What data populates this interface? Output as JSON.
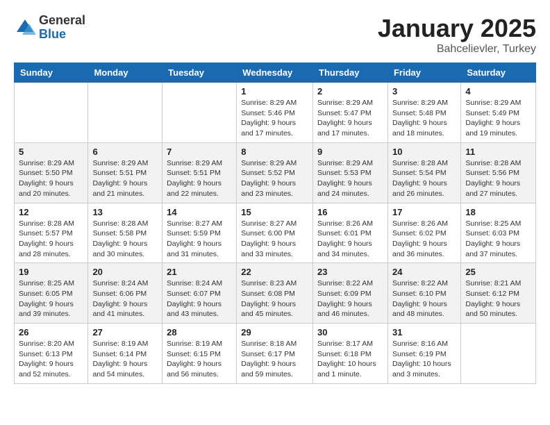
{
  "logo": {
    "general": "General",
    "blue": "Blue"
  },
  "title": {
    "month": "January 2025",
    "location": "Bahcelievler, Turkey"
  },
  "headers": [
    "Sunday",
    "Monday",
    "Tuesday",
    "Wednesday",
    "Thursday",
    "Friday",
    "Saturday"
  ],
  "weeks": [
    [
      {
        "num": "",
        "info": ""
      },
      {
        "num": "",
        "info": ""
      },
      {
        "num": "",
        "info": ""
      },
      {
        "num": "1",
        "info": "Sunrise: 8:29 AM\nSunset: 5:46 PM\nDaylight: 9 hours\nand 17 minutes."
      },
      {
        "num": "2",
        "info": "Sunrise: 8:29 AM\nSunset: 5:47 PM\nDaylight: 9 hours\nand 17 minutes."
      },
      {
        "num": "3",
        "info": "Sunrise: 8:29 AM\nSunset: 5:48 PM\nDaylight: 9 hours\nand 18 minutes."
      },
      {
        "num": "4",
        "info": "Sunrise: 8:29 AM\nSunset: 5:49 PM\nDaylight: 9 hours\nand 19 minutes."
      }
    ],
    [
      {
        "num": "5",
        "info": "Sunrise: 8:29 AM\nSunset: 5:50 PM\nDaylight: 9 hours\nand 20 minutes."
      },
      {
        "num": "6",
        "info": "Sunrise: 8:29 AM\nSunset: 5:51 PM\nDaylight: 9 hours\nand 21 minutes."
      },
      {
        "num": "7",
        "info": "Sunrise: 8:29 AM\nSunset: 5:51 PM\nDaylight: 9 hours\nand 22 minutes."
      },
      {
        "num": "8",
        "info": "Sunrise: 8:29 AM\nSunset: 5:52 PM\nDaylight: 9 hours\nand 23 minutes."
      },
      {
        "num": "9",
        "info": "Sunrise: 8:29 AM\nSunset: 5:53 PM\nDaylight: 9 hours\nand 24 minutes."
      },
      {
        "num": "10",
        "info": "Sunrise: 8:28 AM\nSunset: 5:54 PM\nDaylight: 9 hours\nand 26 minutes."
      },
      {
        "num": "11",
        "info": "Sunrise: 8:28 AM\nSunset: 5:56 PM\nDaylight: 9 hours\nand 27 minutes."
      }
    ],
    [
      {
        "num": "12",
        "info": "Sunrise: 8:28 AM\nSunset: 5:57 PM\nDaylight: 9 hours\nand 28 minutes."
      },
      {
        "num": "13",
        "info": "Sunrise: 8:28 AM\nSunset: 5:58 PM\nDaylight: 9 hours\nand 30 minutes."
      },
      {
        "num": "14",
        "info": "Sunrise: 8:27 AM\nSunset: 5:59 PM\nDaylight: 9 hours\nand 31 minutes."
      },
      {
        "num": "15",
        "info": "Sunrise: 8:27 AM\nSunset: 6:00 PM\nDaylight: 9 hours\nand 33 minutes."
      },
      {
        "num": "16",
        "info": "Sunrise: 8:26 AM\nSunset: 6:01 PM\nDaylight: 9 hours\nand 34 minutes."
      },
      {
        "num": "17",
        "info": "Sunrise: 8:26 AM\nSunset: 6:02 PM\nDaylight: 9 hours\nand 36 minutes."
      },
      {
        "num": "18",
        "info": "Sunrise: 8:25 AM\nSunset: 6:03 PM\nDaylight: 9 hours\nand 37 minutes."
      }
    ],
    [
      {
        "num": "19",
        "info": "Sunrise: 8:25 AM\nSunset: 6:05 PM\nDaylight: 9 hours\nand 39 minutes."
      },
      {
        "num": "20",
        "info": "Sunrise: 8:24 AM\nSunset: 6:06 PM\nDaylight: 9 hours\nand 41 minutes."
      },
      {
        "num": "21",
        "info": "Sunrise: 8:24 AM\nSunset: 6:07 PM\nDaylight: 9 hours\nand 43 minutes."
      },
      {
        "num": "22",
        "info": "Sunrise: 8:23 AM\nSunset: 6:08 PM\nDaylight: 9 hours\nand 45 minutes."
      },
      {
        "num": "23",
        "info": "Sunrise: 8:22 AM\nSunset: 6:09 PM\nDaylight: 9 hours\nand 46 minutes."
      },
      {
        "num": "24",
        "info": "Sunrise: 8:22 AM\nSunset: 6:10 PM\nDaylight: 9 hours\nand 48 minutes."
      },
      {
        "num": "25",
        "info": "Sunrise: 8:21 AM\nSunset: 6:12 PM\nDaylight: 9 hours\nand 50 minutes."
      }
    ],
    [
      {
        "num": "26",
        "info": "Sunrise: 8:20 AM\nSunset: 6:13 PM\nDaylight: 9 hours\nand 52 minutes."
      },
      {
        "num": "27",
        "info": "Sunrise: 8:19 AM\nSunset: 6:14 PM\nDaylight: 9 hours\nand 54 minutes."
      },
      {
        "num": "28",
        "info": "Sunrise: 8:19 AM\nSunset: 6:15 PM\nDaylight: 9 hours\nand 56 minutes."
      },
      {
        "num": "29",
        "info": "Sunrise: 8:18 AM\nSunset: 6:17 PM\nDaylight: 9 hours\nand 59 minutes."
      },
      {
        "num": "30",
        "info": "Sunrise: 8:17 AM\nSunset: 6:18 PM\nDaylight: 10 hours\nand 1 minute."
      },
      {
        "num": "31",
        "info": "Sunrise: 8:16 AM\nSunset: 6:19 PM\nDaylight: 10 hours\nand 3 minutes."
      },
      {
        "num": "",
        "info": ""
      }
    ]
  ]
}
